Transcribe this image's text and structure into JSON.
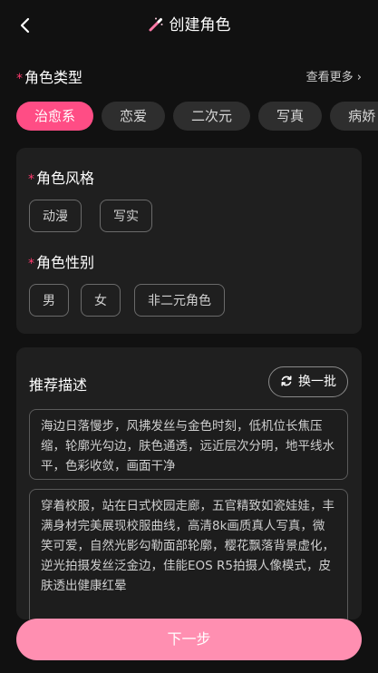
{
  "header": {
    "title": "创建角色"
  },
  "role_type": {
    "required_mark": "*",
    "label": "角色类型",
    "more": "查看更多 ›",
    "options": [
      "治愈系",
      "恋爱",
      "二次元",
      "写真",
      "病娇"
    ],
    "selected": "治愈系"
  },
  "style": {
    "required_mark": "*",
    "label": "角色风格",
    "options": [
      "动漫",
      "写实"
    ]
  },
  "gender": {
    "required_mark": "*",
    "label": "角色性别",
    "options": [
      "男",
      "女",
      "非二元角色"
    ]
  },
  "recommend": {
    "label": "推荐描述",
    "refresh_label": "换一批",
    "items": [
      "海边日落慢步，风拂发丝与金色时刻，低机位长焦压缩，轮廓光勾边，肤色通透，远近层次分明，地平线水平，色彩收敛，画面干净",
      "穿着校服，站在日式校园走廊，五官精致如瓷娃娃，丰满身材完美展现校服曲线，高清8k画质真人写真，微笑可爱，自然光影勾勒面部轮廓，樱花飘落背景虚化，逆光拍摄发丝泛金边，佳能EOS R5拍摄人像模式，皮肤透出健康红晕"
    ]
  },
  "footer": {
    "next_label": "下一步"
  },
  "colors": {
    "accent": "#ff4d85",
    "next_button": "#ff8fb1",
    "required": "#ff3b6f"
  }
}
